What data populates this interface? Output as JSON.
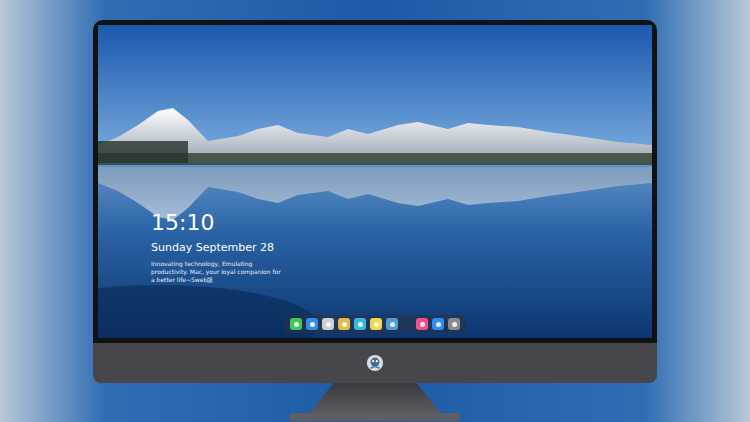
{
  "lock_screen": {
    "time": "15:10",
    "date": "Sunday September 28",
    "tagline": "Innovating technology, Emulating productivity. Mac, your loyal companion for a better life~Sweb版"
  },
  "dock": {
    "items": [
      {
        "color": "#3cc85a"
      },
      {
        "color": "#2f8fe6"
      },
      {
        "color": "#cfcfd4"
      },
      {
        "color": "#e8b84a"
      },
      {
        "color": "#39b6e8"
      },
      {
        "color": "#f5d64a"
      },
      {
        "color": "#4f9be0"
      },
      {
        "color": "#f0508c"
      },
      {
        "color": "#2f8ff0"
      },
      {
        "color": "#8a8a90"
      }
    ]
  }
}
